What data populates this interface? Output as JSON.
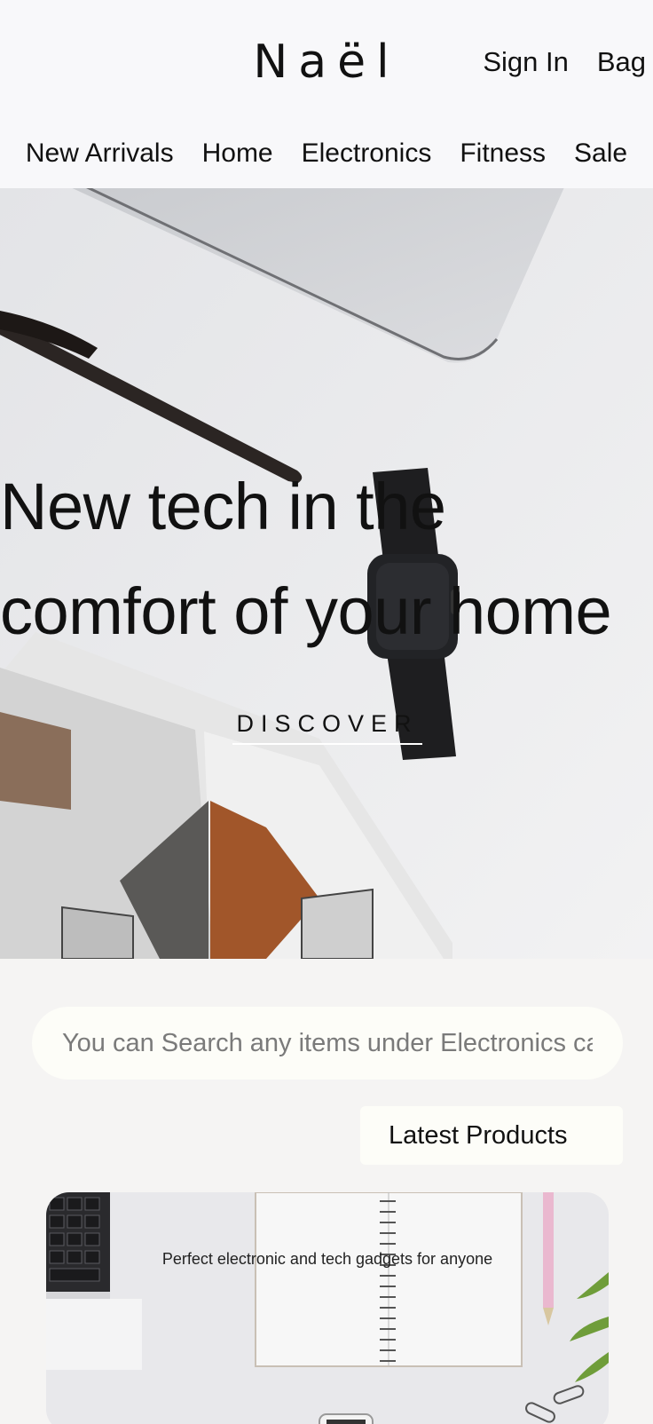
{
  "header": {
    "logo": "Naël",
    "links": {
      "sign_in": "Sign In",
      "bag": "Bag"
    },
    "nav": [
      "New Arrivals",
      "Home",
      "Electronics",
      "Fitness",
      "Sale"
    ]
  },
  "hero": {
    "title_line1": "New tech in the",
    "title_line2": "comfort of your home",
    "cta": "DISCOVER"
  },
  "search": {
    "placeholder": "You can Search any items under Electronics ca"
  },
  "latest_button": "Latest Products",
  "product_card": {
    "caption": "Perfect electronic and tech gadgets for anyone"
  }
}
